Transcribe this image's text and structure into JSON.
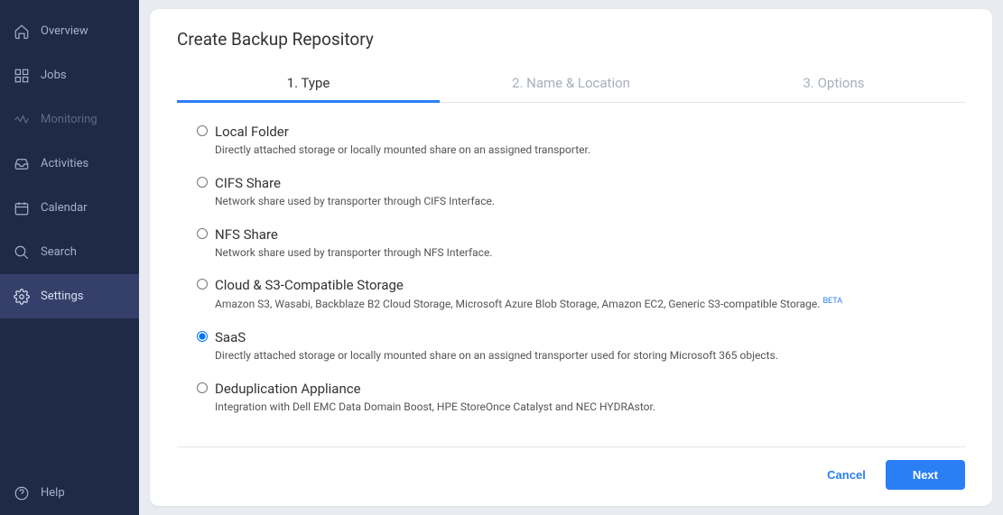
{
  "sidebar": {
    "items": [
      {
        "label": "Overview"
      },
      {
        "label": "Jobs"
      },
      {
        "label": "Monitoring"
      },
      {
        "label": "Activities"
      },
      {
        "label": "Calendar"
      },
      {
        "label": "Search"
      },
      {
        "label": "Settings"
      }
    ],
    "help_label": "Help"
  },
  "panel": {
    "title": "Create Backup Repository",
    "tabs": [
      {
        "label": "1. Type"
      },
      {
        "label": "2. Name & Location"
      },
      {
        "label": "3. Options"
      }
    ],
    "options": [
      {
        "title": "Local Folder",
        "desc": "Directly attached storage or locally mounted share on an assigned transporter."
      },
      {
        "title": "CIFS Share",
        "desc": "Network share used by transporter through CIFS Interface."
      },
      {
        "title": "NFS Share",
        "desc": "Network share used by transporter through NFS Interface."
      },
      {
        "title": "Cloud & S3-Compatible Storage",
        "desc": "Amazon S3, Wasabi, Backblaze B2 Cloud Storage, Microsoft Azure Blob Storage, Amazon EC2, Generic S3-compatible Storage.",
        "beta": "BETA"
      },
      {
        "title": "SaaS",
        "desc": "Directly attached storage or locally mounted share on an assigned transporter used for storing Microsoft 365 objects."
      },
      {
        "title": "Deduplication Appliance",
        "desc": "Integration with Dell EMC Data Domain Boost, HPE StoreOnce Catalyst and NEC HYDRAstor."
      }
    ],
    "footer": {
      "cancel": "Cancel",
      "next": "Next"
    }
  }
}
